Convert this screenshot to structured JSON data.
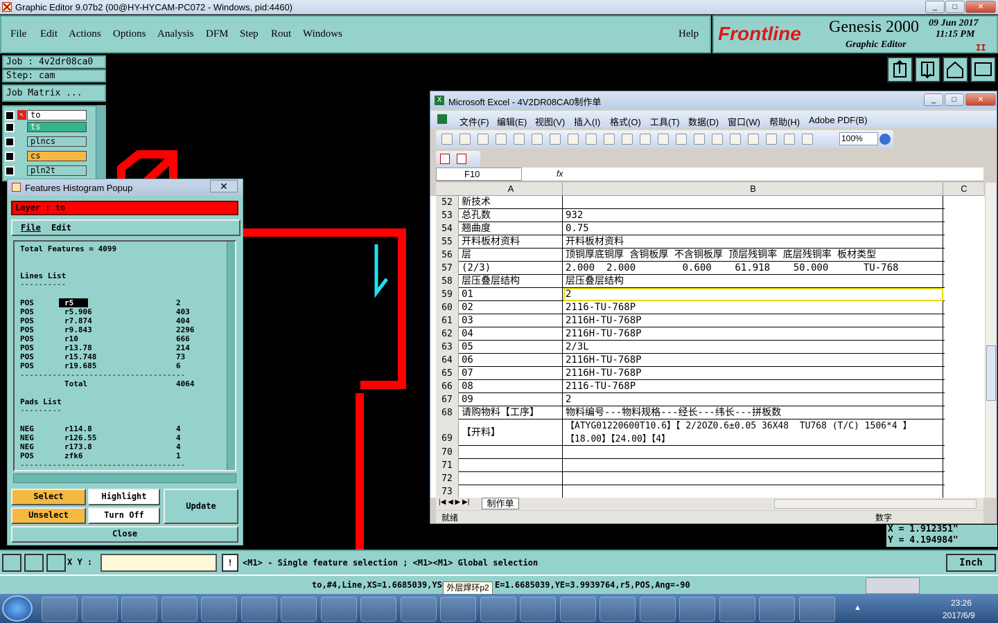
{
  "window_title": "Graphic Editor 9.07b2 (00@HY-HYCAM-PC072 - Windows, pid:4460)",
  "menu": [
    "File",
    "Edit",
    "Actions",
    "Options",
    "Analysis",
    "DFM",
    "Step",
    "Rout",
    "Windows"
  ],
  "help": "Help",
  "logo": {
    "brand": "Frontline",
    "product": "Genesis 2000",
    "sub": "Graphic Editor",
    "date": "09 Jun 2017",
    "time": "11:15 PM"
  },
  "job": {
    "job_label": "Job : 4v2dr08ca0",
    "step_label": "Step: cam",
    "matrix_button": "Job Matrix ..."
  },
  "layers": [
    {
      "name": "to",
      "color": "#ffffff"
    },
    {
      "name": "ts",
      "color": "#33b58a"
    },
    {
      "name": "plncs",
      "color": "#96d2cc"
    },
    {
      "name": "cs",
      "color": "#f5b942"
    },
    {
      "name": "pln2t",
      "color": "#96d2cc"
    }
  ],
  "histogram": {
    "title": "Features Histogram Popup",
    "layer_label": "Layer :  to",
    "file": "File",
    "edit": "Edit",
    "total": "Total Features = 4099",
    "lines_header": "Lines List",
    "lines": [
      {
        "pol": "POS",
        "sym": "r5",
        "count": "2"
      },
      {
        "pol": "POS",
        "sym": "r5.906",
        "count": "403"
      },
      {
        "pol": "POS",
        "sym": "r7.874",
        "count": "404"
      },
      {
        "pol": "POS",
        "sym": "r9.843",
        "count": "2296"
      },
      {
        "pol": "POS",
        "sym": "r10",
        "count": "666"
      },
      {
        "pol": "POS",
        "sym": "r13.78",
        "count": "214"
      },
      {
        "pol": "POS",
        "sym": "r15.748",
        "count": "73"
      },
      {
        "pol": "POS",
        "sym": "r19.685",
        "count": "6"
      }
    ],
    "lines_total_label": "Total",
    "lines_total": "4064",
    "pads_header": "Pads List",
    "pads": [
      {
        "pol": "NEG",
        "sym": "r114.8",
        "count": "4"
      },
      {
        "pol": "NEG",
        "sym": "r126.55",
        "count": "4"
      },
      {
        "pol": "NEG",
        "sym": "r173.8",
        "count": "4"
      },
      {
        "pol": "POS",
        "sym": "zfk6",
        "count": "1"
      }
    ],
    "btn_select": "Select",
    "btn_highlight": "Highlight",
    "btn_update": "Update",
    "btn_unselect": "Unselect",
    "btn_turnoff": "Turn Off",
    "btn_close": "Close"
  },
  "excel": {
    "title": "Microsoft Excel - 4V2DR08CA0制作单",
    "menus": [
      "文件(F)",
      "编辑(E)",
      "视图(V)",
      "插入(I)",
      "格式(O)",
      "工具(T)",
      "数据(D)",
      "窗口(W)",
      "帮助(H)",
      "Adobe PDF(B)"
    ],
    "zoom": "100%",
    "cell_ref": "F10",
    "fx": "fx",
    "col_a": "A",
    "col_b": "B",
    "col_c": "C",
    "rows": [
      {
        "n": "52",
        "a": "新技术",
        "b": ""
      },
      {
        "n": "53",
        "a": "总孔数",
        "b": "932"
      },
      {
        "n": "54",
        "a": "翘曲度",
        "b": "0.75"
      },
      {
        "n": "55",
        "a": "开料板材资料",
        "b": "开料板材资料"
      },
      {
        "n": "56",
        "a": "层",
        "b": "顶铜厚底铜厚 含铜板厚 不含铜板厚 顶层残铜率 底层残铜率 板材类型"
      },
      {
        "n": "57",
        "a": "(2/3)",
        "b": "2.000  2.000        0.600    61.918    50.000      TU-768"
      },
      {
        "n": "58",
        "a": "层压叠层结构",
        "b": "层压叠层结构"
      },
      {
        "n": "59",
        "a": "01",
        "b": "2"
      },
      {
        "n": "60",
        "a": "02",
        "b": "2116-TU-768P"
      },
      {
        "n": "61",
        "a": "03",
        "b": "2116H-TU-768P"
      },
      {
        "n": "62",
        "a": "04",
        "b": "2116H-TU-768P"
      },
      {
        "n": "63",
        "a": "05",
        "b": "2/3L"
      },
      {
        "n": "64",
        "a": "06",
        "b": "2116H-TU-768P"
      },
      {
        "n": "65",
        "a": "07",
        "b": "2116H-TU-768P"
      },
      {
        "n": "66",
        "a": "08",
        "b": "2116-TU-768P"
      },
      {
        "n": "67",
        "a": "09",
        "b": "2"
      },
      {
        "n": "68",
        "a": "请购物料【工序】",
        "b": "物料编号---物料规格---经长---纬长---拼板数"
      }
    ],
    "row69": {
      "n": "69",
      "a": "【开料】",
      "b1": "【ATYG01220600T10.6】【 2/2OZ0.6±0.05 36X48  TU768 (T/C) 1506*4 】",
      "b2": "【18.00】【24.00】【4】"
    },
    "empty_rows": [
      "70",
      "71",
      "72",
      "73"
    ],
    "sheet_tab": "制作单",
    "status_left": "就绪",
    "status_right": "数字"
  },
  "coords": {
    "x": "X = 1.912351\"",
    "y": "Y = 4.194984\""
  },
  "xy_label": "X Y :",
  "prompt": "<M1> - Single feature selection ; <M1><M1> Global selection",
  "units": "Inch",
  "status_line": "to,#4,Line,XS=1.6685039,YS=",
  "status_line_right": "E=1.6685039,YE=3.9939764,r5,POS,Ang=-90",
  "tooltip": "外层焊环p2",
  "clock": {
    "time": "23:26",
    "date": "2017/6/9"
  }
}
